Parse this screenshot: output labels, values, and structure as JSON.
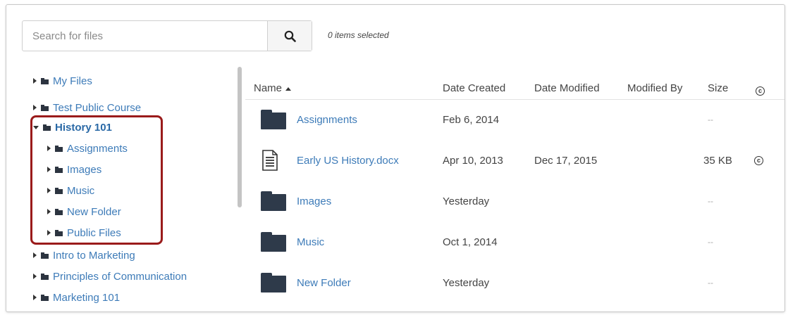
{
  "toolbar": {
    "search_placeholder": "Search for files",
    "search_icon": "search-icon",
    "selected_count": "0 items selected"
  },
  "tree": {
    "items": [
      {
        "label": "My Files",
        "state": "collapsed",
        "level": 0
      },
      {
        "label": "Test Public Course",
        "state": "collapsed",
        "level": 0
      },
      {
        "label": "History 101",
        "state": "expanded",
        "level": 0,
        "bold": true
      },
      {
        "label": "Assignments",
        "state": "collapsed",
        "level": 1
      },
      {
        "label": "Images",
        "state": "collapsed",
        "level": 1
      },
      {
        "label": "Music",
        "state": "collapsed",
        "level": 1
      },
      {
        "label": "New Folder",
        "state": "collapsed",
        "level": 1
      },
      {
        "label": "Public Files",
        "state": "collapsed",
        "level": 1
      },
      {
        "label": "Intro to Marketing",
        "state": "collapsed",
        "level": 0
      },
      {
        "label": "Principles of Communication",
        "state": "collapsed",
        "level": 0
      },
      {
        "label": "Marketing 101",
        "state": "collapsed",
        "level": 0
      }
    ],
    "highlight_color": "#9a1b1b"
  },
  "list": {
    "columns": {
      "name": "Name",
      "date_created": "Date Created",
      "date_modified": "Date Modified",
      "modified_by": "Modified By",
      "size": "Size",
      "usage_rights_icon": "copyright-icon"
    },
    "rows": [
      {
        "type": "folder",
        "name": "Assignments",
        "date_created": "Feb 6, 2014",
        "date_modified": "",
        "modified_by": "",
        "size": "--"
      },
      {
        "type": "document",
        "name": "Early US History.docx",
        "date_created": "Apr 10, 2013",
        "date_modified": "Dec 17, 2015",
        "modified_by": "",
        "size": "35 KB",
        "usage_rights": "©"
      },
      {
        "type": "folder",
        "name": "Images",
        "date_created": "Yesterday",
        "date_modified": "",
        "modified_by": "",
        "size": "--"
      },
      {
        "type": "folder",
        "name": "Music",
        "date_created": "Oct 1, 2014",
        "date_modified": "",
        "modified_by": "",
        "size": "--"
      },
      {
        "type": "folder",
        "name": "New Folder",
        "date_created": "Yesterday",
        "date_modified": "",
        "modified_by": "",
        "size": "--"
      }
    ]
  },
  "colors": {
    "link": "#3d7bb8",
    "folder": "#2e3a4a",
    "border": "#c9c9c9"
  }
}
